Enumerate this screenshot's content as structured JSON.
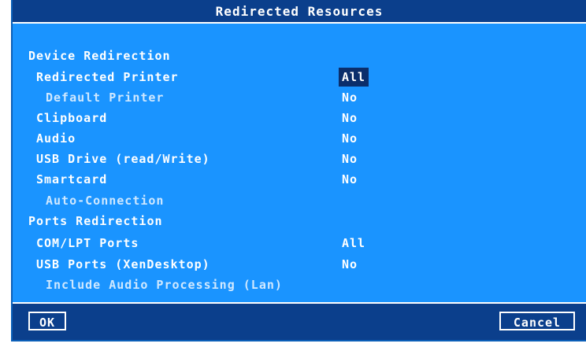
{
  "dialog": {
    "title": "Redirected Resources",
    "sections": {
      "device": "Device Redirection",
      "ports": "Ports Redirection"
    },
    "items": {
      "redirected_printer": {
        "label": "Redirected Printer",
        "value": "All"
      },
      "default_printer": {
        "label": "Default Printer",
        "value": "No"
      },
      "clipboard": {
        "label": "Clipboard",
        "value": "No"
      },
      "audio": {
        "label": "Audio",
        "value": "No"
      },
      "usb_drive": {
        "label": "USB Drive (read/Write)",
        "value": "No"
      },
      "smartcard": {
        "label": "Smartcard",
        "value": "No"
      },
      "auto_connection": {
        "label": "Auto-Connection"
      },
      "com_lpt": {
        "label": "COM/LPT Ports",
        "value": "All"
      },
      "usb_ports": {
        "label": "USB Ports (XenDesktop)",
        "value": "No"
      },
      "include_audio": {
        "label": "Include Audio Processing (Lan)"
      }
    },
    "buttons": {
      "ok": "OK",
      "cancel": "Cancel"
    }
  },
  "colors": {
    "background": "#1a94ff",
    "titlebar": "#0b3f8c",
    "selection": "#0b2e6b",
    "text": "#ffffff",
    "disabled_text": "#cfe8ff"
  }
}
